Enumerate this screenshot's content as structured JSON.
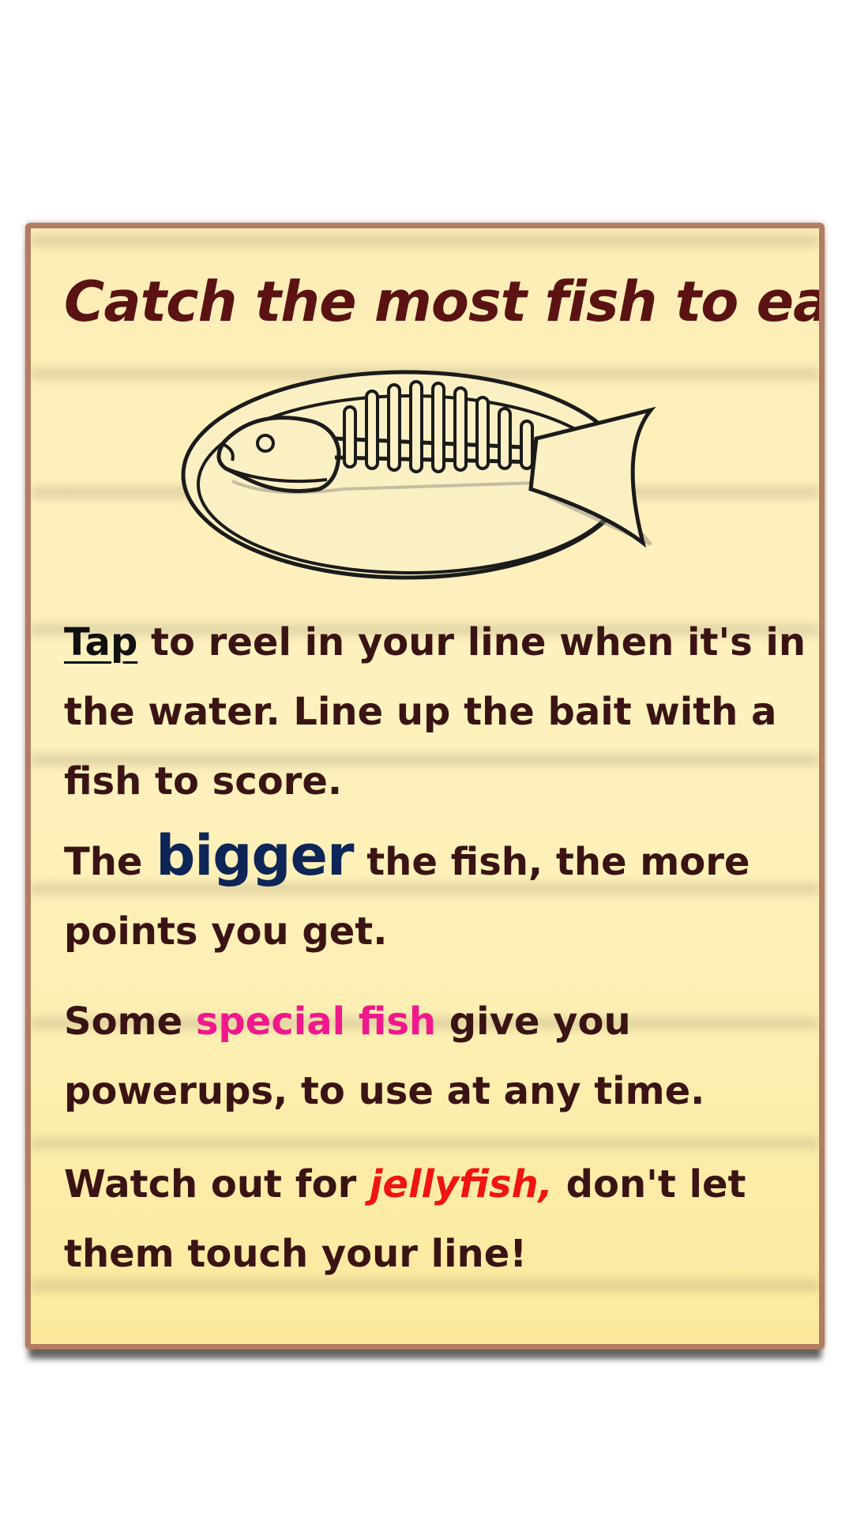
{
  "card": {
    "title": "Catch the most fish to eat!",
    "illustration_icon": "fish-skeleton-on-plate-icon",
    "instructions": [
      {
        "before": "",
        "keyword": "Tap",
        "after": " to reel in your line when it's in the water. Line up the bait with a fish to score."
      },
      {
        "before": "The ",
        "keyword": "bigger",
        "after": " the fish, the more points you get."
      },
      {
        "before": "Some ",
        "keyword": "special fish",
        "after": " give you powerups, to use at any time."
      },
      {
        "before": "Watch out for ",
        "keyword": "jellyfish,",
        "after": " don't let them touch your line!"
      }
    ]
  },
  "colors": {
    "title": "#5a1212",
    "body_text": "#3a1414",
    "card_background": "#fdeeb6",
    "card_border": "#b27d63",
    "keyword_tap": "#111111",
    "keyword_bigger": "#0d2557",
    "keyword_special_fish": "#f0188c",
    "keyword_jellyfish": "#f01414"
  }
}
